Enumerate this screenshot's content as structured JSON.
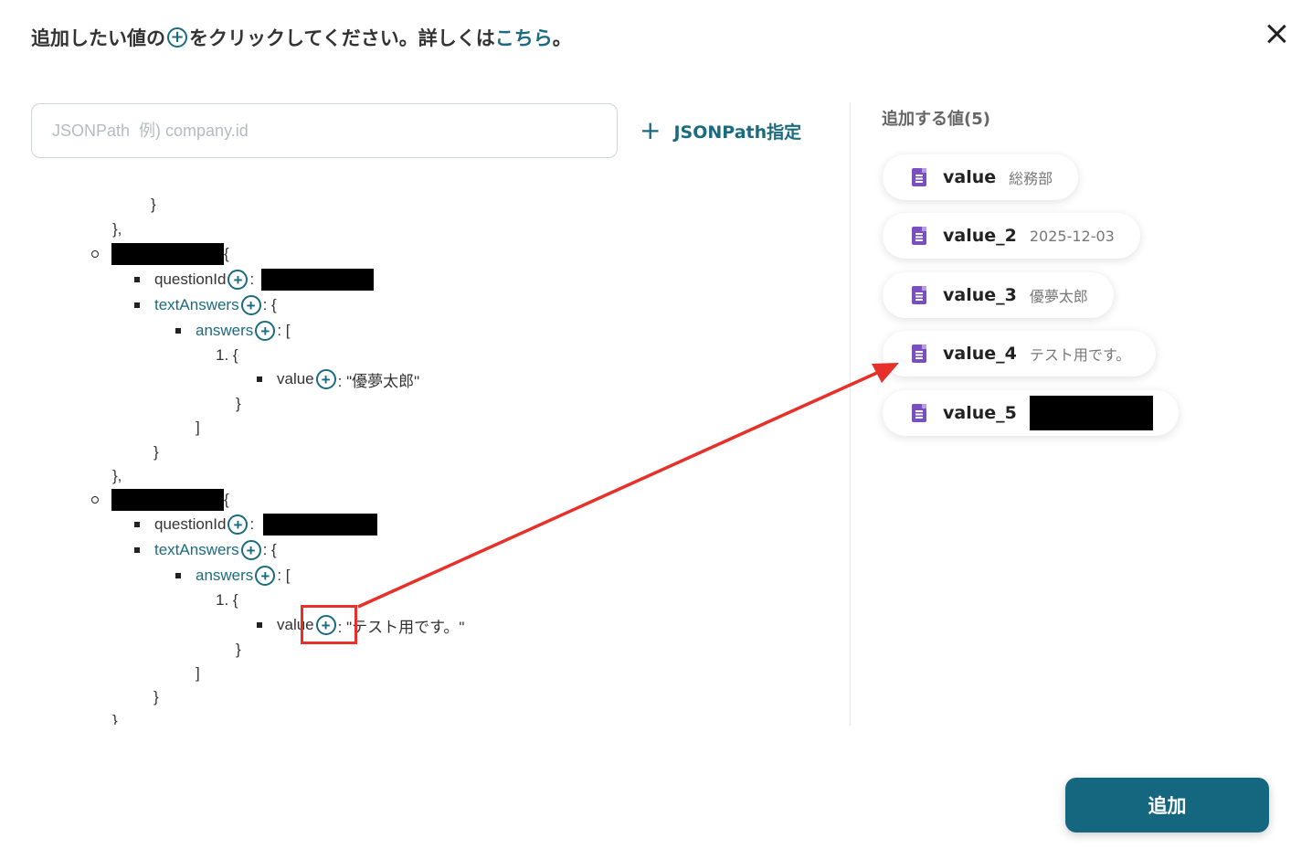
{
  "header": {
    "title_before": "追加したい値の",
    "title_after": "をクリックしてください。詳しくは",
    "link_label": "こちら",
    "title_end": "。"
  },
  "search": {
    "placeholder": "JSONPath  例) company.id",
    "value": ""
  },
  "jsonpath_button": {
    "label": "JSONPath指定"
  },
  "tree": {
    "close_brace": "}",
    "close_brace_comma": "},",
    "open_brace": "{",
    "close_bracket": "]",
    "question_id": "questionId",
    "text_answers": "textAnswers",
    "answers": "answers",
    "value_key": "value",
    "colon": ":",
    "colon_brace": ": {",
    "colon_bracket": ": [",
    "item_1": "1. {",
    "value_1": ": \"優夢太郎\"",
    "value_2": ": \"テスト用です。\""
  },
  "values_panel": {
    "title": "追加する値(5)",
    "items": [
      {
        "name": "value",
        "value": "総務部"
      },
      {
        "name": "value_2",
        "value": "2025-12-03"
      },
      {
        "name": "value_3",
        "value": "優夢太郎"
      },
      {
        "name": "value_4",
        "value": "テスト用です。"
      },
      {
        "name": "value_5",
        "value": ""
      }
    ]
  },
  "add_button": {
    "label": "追加"
  },
  "colors": {
    "accent": "#1a6b80",
    "button": "#14677e",
    "annotation": "#e8302a",
    "doc_icon": "#7a4fc0"
  },
  "icons": [
    "plus-circle-icon",
    "close-icon",
    "plus-icon",
    "document-icon"
  ]
}
